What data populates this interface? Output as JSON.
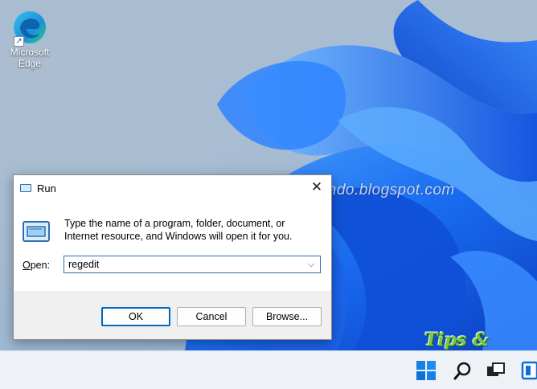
{
  "desktop": {
    "icons": [
      {
        "label_line1": "Microsoft",
        "label_line2": "Edge",
        "icon": "edge-icon"
      }
    ],
    "watermark": "mastertipsorialindo.blogspot.com",
    "badge": "Tips & Tutorial"
  },
  "run_dialog": {
    "title": "Run",
    "close_glyph": "✕",
    "description": "Type the name of a program, folder, document, or Internet resource, and Windows will open it for you.",
    "open_label_prefix": "O",
    "open_label_rest": "pen:",
    "open_value": "regedit",
    "buttons": {
      "ok": "OK",
      "cancel": "Cancel",
      "browse": "Browse..."
    }
  },
  "taskbar": {
    "icons": [
      "windows-start-icon",
      "search-icon",
      "task-view-icon",
      "widgets-icon"
    ]
  },
  "colors": {
    "accent": "#0067c0",
    "wallpaper_blue": "#1a6cf0"
  }
}
